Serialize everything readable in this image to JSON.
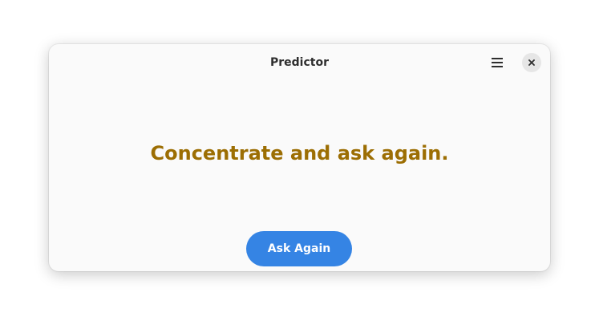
{
  "window": {
    "title": "Predictor"
  },
  "headerbar": {
    "menu_icon": "hamburger-menu-icon",
    "close_icon": "close-icon"
  },
  "main": {
    "answer": "Concentrate and ask again.",
    "ask_button_label": "Ask Again"
  },
  "colors": {
    "answer": "#9c6e03",
    "accent": "#3584e4"
  }
}
